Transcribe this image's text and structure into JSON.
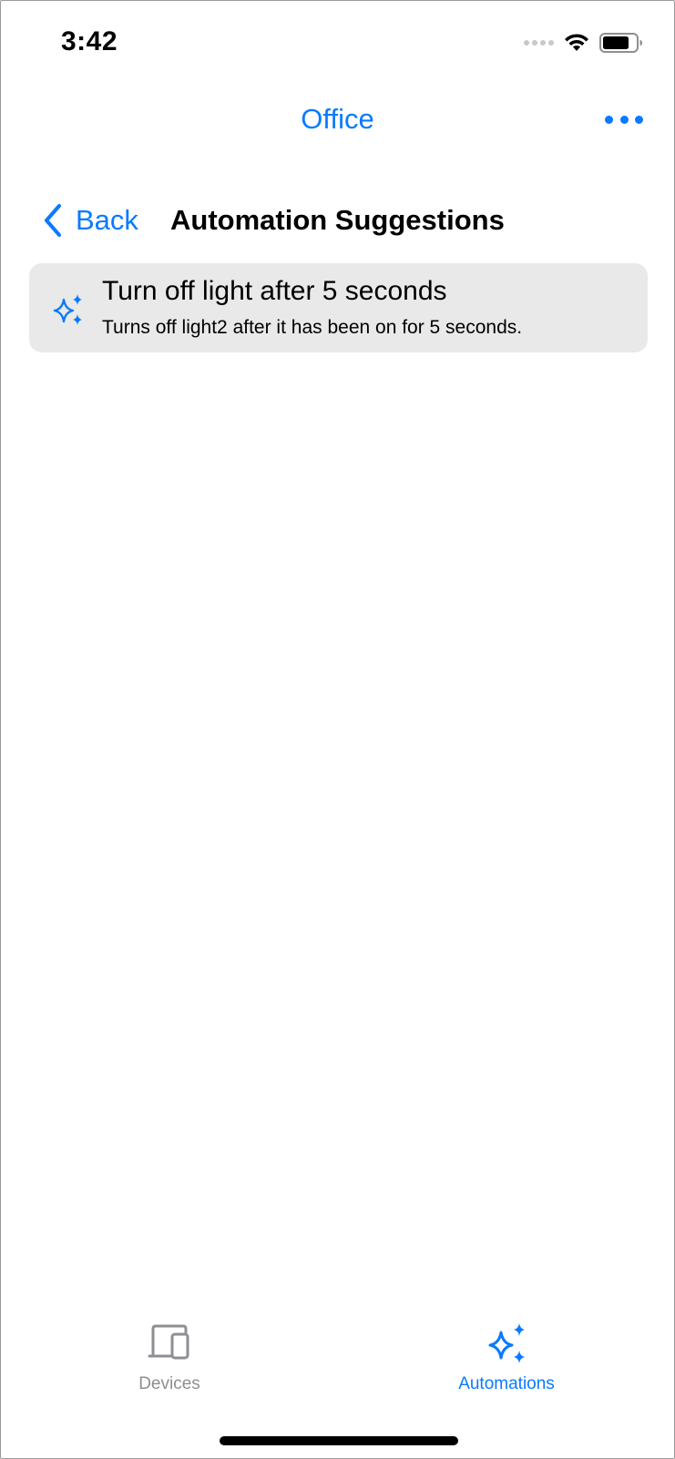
{
  "status_bar": {
    "time": "3:42"
  },
  "nav": {
    "title": "Office",
    "back_label": "Back",
    "page_title": "Automation Suggestions"
  },
  "suggestions": [
    {
      "title": "Turn off light after 5 seconds",
      "subtitle": "Turns off light2 after it has been on for 5 seconds.",
      "icon": "sparkles-icon"
    }
  ],
  "tab_bar": {
    "tabs": [
      {
        "label": "Devices",
        "icon": "devices-icon",
        "selected": false
      },
      {
        "label": "Automations",
        "icon": "sparkles-icon",
        "selected": true
      }
    ]
  },
  "colors": {
    "accent": "#0a7aff",
    "card_background": "#e9e9e9",
    "inactive_tab": "#8e8e93"
  }
}
